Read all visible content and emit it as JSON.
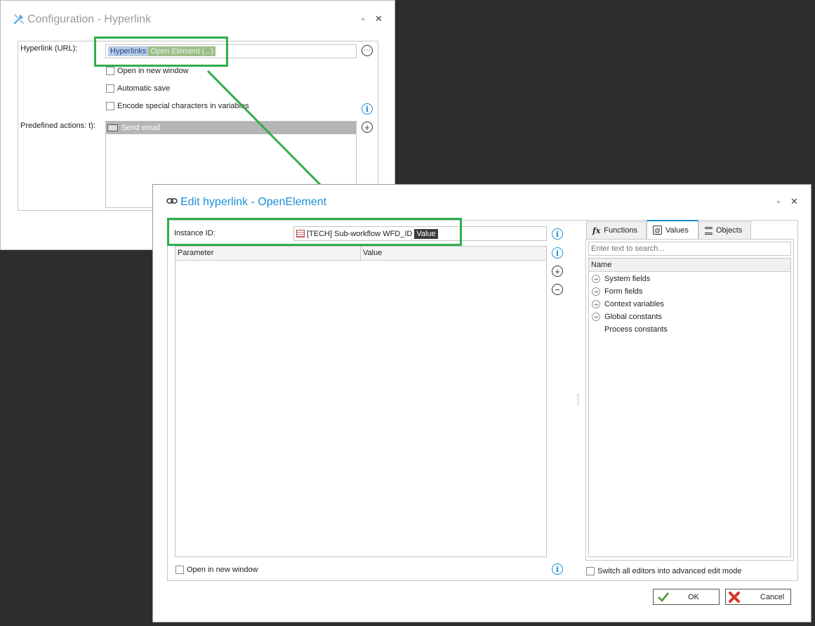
{
  "config_dialog": {
    "title": "Configuration - Hyperlink",
    "hyperlink_label": "Hyperlink (URL):",
    "hyperlink_chip_1": "Hyperlinks",
    "hyperlink_chip_2": "Open Element (...)",
    "open_new_window": "Open in new window",
    "automatic_save": "Automatic save",
    "encode_special": "Encode special characters in variables",
    "predefined_label": "Predefined actions: t):",
    "actions": [
      "Send email"
    ]
  },
  "edit_dialog": {
    "title": "Edit hyperlink - OpenElement",
    "instance_id_label": "Instance ID:",
    "instance_value_text": "[TECH] Sub-workflow WFD_ID",
    "instance_value_chip": "Value",
    "grid_columns": [
      "Parameter",
      "Value"
    ],
    "open_new_window": "Open in new window",
    "advanced_mode": "Switch all editors into advanced edit mode",
    "tabs": [
      "Functions",
      "Values",
      "Objects"
    ],
    "active_tab": "Values",
    "search_placeholder": "Enter text to search...",
    "tree_header": "Name",
    "tree_items": [
      "System fields",
      "Form fields",
      "Context variables",
      "Global constants",
      "Process constants"
    ],
    "ok_label": "OK",
    "cancel_label": "Cancel"
  },
  "colors": {
    "highlight_green": "#2fae4a",
    "title_blue": "#1a8fd6",
    "desktop": "#2d2d2d"
  }
}
